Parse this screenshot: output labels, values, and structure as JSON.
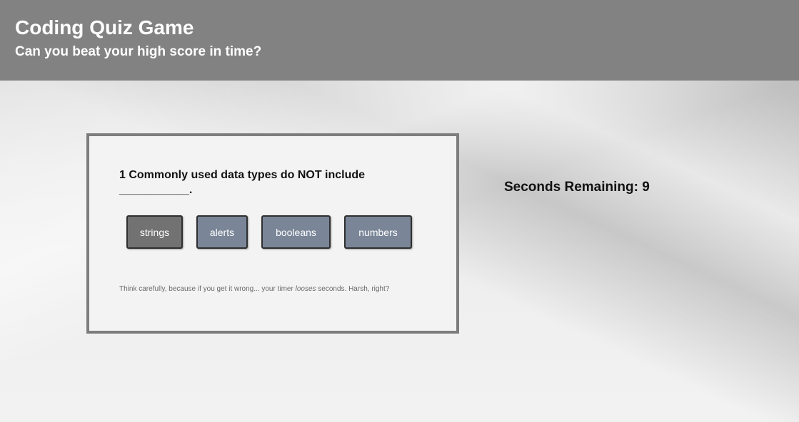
{
  "header": {
    "title": "Coding Quiz Game",
    "subtitle": "Can you beat your high score in time?"
  },
  "quiz": {
    "question": "1 Commonly used data types do NOT include ___________.",
    "answers": [
      {
        "label": "strings",
        "color": "#727272"
      },
      {
        "label": "alerts",
        "color": "#7a8698"
      },
      {
        "label": "booleans",
        "color": "#7a8698"
      },
      {
        "label": "numbers",
        "color": "#7a8698"
      }
    ],
    "hint_before": "Think carefully, because if you get it wrong... your timer ",
    "hint_emphasis": "looses",
    "hint_after": " seconds. Harsh, right?"
  },
  "timer": {
    "text": "Seconds Remaining: 9"
  },
  "colors": {
    "header_bg": "#828282",
    "card_border": "#7d7d7d",
    "answer_default": "#7a8698",
    "answer_selected": "#727272"
  }
}
